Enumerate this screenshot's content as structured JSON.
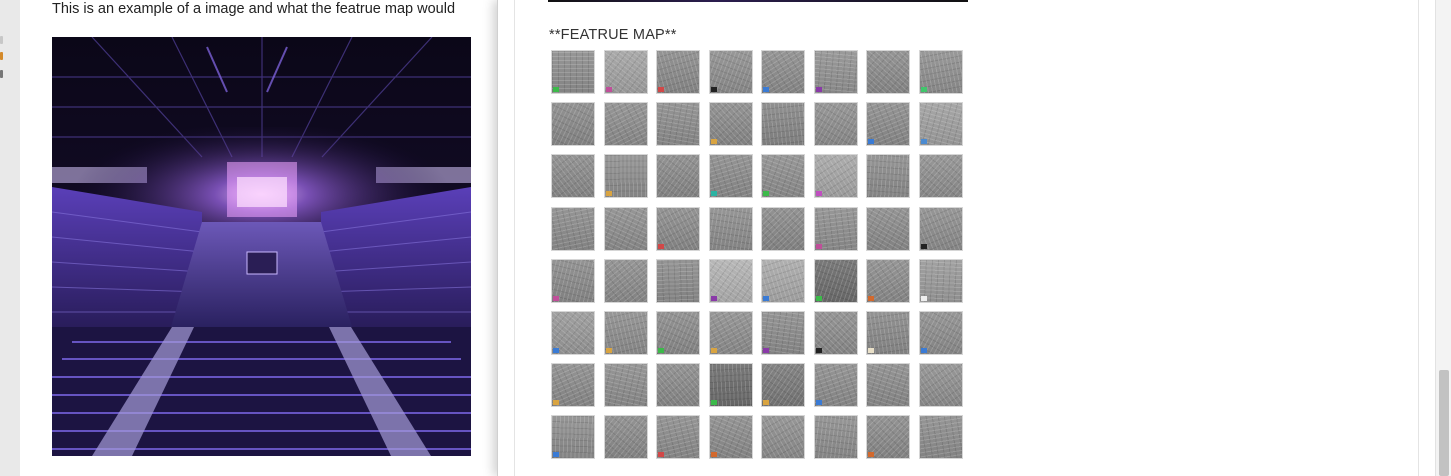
{
  "document": {
    "caption": "This is an example of a image and what the featrue map would"
  },
  "popup": {
    "title": "**FEATRUE MAP**"
  },
  "feature_map": {
    "rows": 8,
    "cols": 8,
    "tiles": [
      {
        "tone": "#8e8e8e",
        "blip": "#3cba4a"
      },
      {
        "tone": "#a3a3a3",
        "blip": "#c04f9a"
      },
      {
        "tone": "#8b8b8b",
        "blip": "#d24848"
      },
      {
        "tone": "#8f8f8f",
        "blip": "#222222"
      },
      {
        "tone": "#8d8d8d",
        "blip": "#3a7bd5"
      },
      {
        "tone": "#929292",
        "blip": "#8a3aa8"
      },
      {
        "tone": "#8c8c8c",
        "blip": ""
      },
      {
        "tone": "#909090",
        "blip": "#41c66c"
      },
      {
        "tone": "#8a8a8a",
        "blip": ""
      },
      {
        "tone": "#8e8e8e",
        "blip": ""
      },
      {
        "tone": "#8d8d8d",
        "blip": ""
      },
      {
        "tone": "#8b8b8b",
        "blip": "#d9a441"
      },
      {
        "tone": "#878787",
        "blip": ""
      },
      {
        "tone": "#8f8f8f",
        "blip": ""
      },
      {
        "tone": "#8c8c8c",
        "blip": "#3a7bd5"
      },
      {
        "tone": "#a0a0a0",
        "blip": "#4b8bd1"
      },
      {
        "tone": "#8b8b8b",
        "blip": ""
      },
      {
        "tone": "#8e8e8e",
        "blip": "#d9a441"
      },
      {
        "tone": "#8a8a8a",
        "blip": ""
      },
      {
        "tone": "#8c8c8c",
        "blip": "#2bb3a3"
      },
      {
        "tone": "#8f8f8f",
        "blip": "#3cba4a"
      },
      {
        "tone": "#a6a6a6",
        "blip": "#c04fc0"
      },
      {
        "tone": "#8d8d8d",
        "blip": ""
      },
      {
        "tone": "#909090",
        "blip": ""
      },
      {
        "tone": "#8c8c8c",
        "blip": ""
      },
      {
        "tone": "#8e8e8e",
        "blip": ""
      },
      {
        "tone": "#8b8b8b",
        "blip": "#d24848"
      },
      {
        "tone": "#8d8d8d",
        "blip": ""
      },
      {
        "tone": "#8a8a8a",
        "blip": ""
      },
      {
        "tone": "#8f8f8f",
        "blip": "#c04f9a"
      },
      {
        "tone": "#8c8c8c",
        "blip": ""
      },
      {
        "tone": "#8e8e8e",
        "blip": "#222222"
      },
      {
        "tone": "#8b8b8b",
        "blip": "#c04f9a"
      },
      {
        "tone": "#8d8d8d",
        "blip": ""
      },
      {
        "tone": "#8c8c8c",
        "blip": ""
      },
      {
        "tone": "#b2b2b2",
        "blip": "#8a3aa8"
      },
      {
        "tone": "#a9a9a9",
        "blip": "#3a7bd5"
      },
      {
        "tone": "#6e6e6e",
        "blip": "#3cba4a"
      },
      {
        "tone": "#8d8d8d",
        "blip": "#d2692e"
      },
      {
        "tone": "#9a9a9a",
        "blip": "#eeeeee"
      },
      {
        "tone": "#999999",
        "blip": "#3a7bd5"
      },
      {
        "tone": "#8e8e8e",
        "blip": "#d9a441"
      },
      {
        "tone": "#8b8b8b",
        "blip": "#3cba4a"
      },
      {
        "tone": "#8f8f8f",
        "blip": "#d9a441"
      },
      {
        "tone": "#8c8c8c",
        "blip": "#8a3aa8"
      },
      {
        "tone": "#8d8d8d",
        "blip": "#222222"
      },
      {
        "tone": "#8a8a8a",
        "blip": "#e9e0c8"
      },
      {
        "tone": "#8e8e8e",
        "blip": "#3a7bd5"
      },
      {
        "tone": "#8c8c8c",
        "blip": "#d9a441"
      },
      {
        "tone": "#8e8e8e",
        "blip": ""
      },
      {
        "tone": "#8b8b8b",
        "blip": ""
      },
      {
        "tone": "#6d6d6d",
        "blip": "#3cba4a"
      },
      {
        "tone": "#7a7a7a",
        "blip": "#d9a441"
      },
      {
        "tone": "#8d8d8d",
        "blip": "#3a7bd5"
      },
      {
        "tone": "#8c8c8c",
        "blip": ""
      },
      {
        "tone": "#909090",
        "blip": ""
      },
      {
        "tone": "#8e8e8e",
        "blip": "#3a7bd5"
      },
      {
        "tone": "#8b8b8b",
        "blip": ""
      },
      {
        "tone": "#8d8d8d",
        "blip": "#d24848"
      },
      {
        "tone": "#8c8c8c",
        "blip": "#d2692e"
      },
      {
        "tone": "#8f8f8f",
        "blip": ""
      },
      {
        "tone": "#8e8e8e",
        "blip": ""
      },
      {
        "tone": "#8b8b8b",
        "blip": "#d2692e"
      },
      {
        "tone": "#8d8d8d",
        "blip": ""
      }
    ]
  },
  "colors": {
    "arena_purple": "#6a3fd1",
    "stage_pink": "#e28cf0",
    "popup_background": "#ffffff",
    "scrollbar_thumb": "#c2c2c2"
  },
  "scrollbar": {
    "visible": true
  }
}
